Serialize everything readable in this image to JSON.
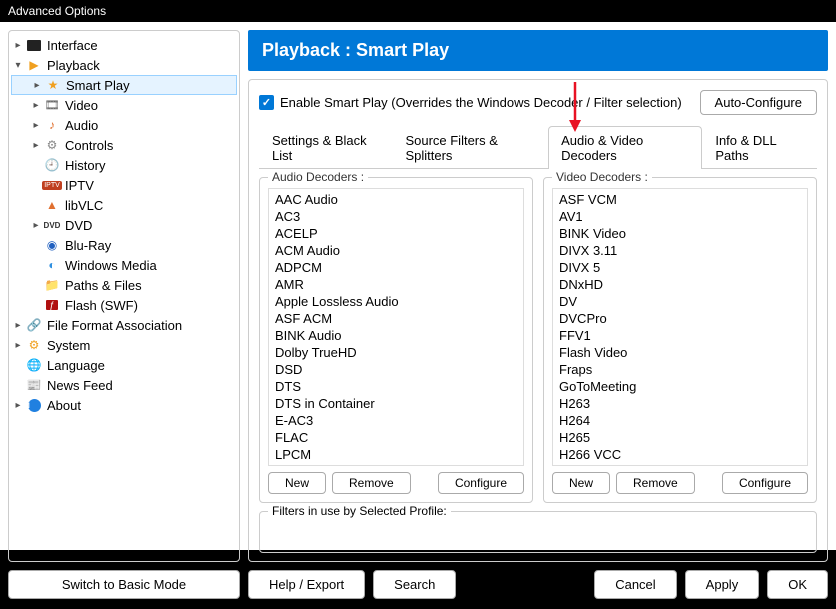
{
  "window_title": "Advanced Options",
  "header": "Playback : Smart Play",
  "enable_label": "Enable Smart Play (Overrides the Windows Decoder / Filter selection)",
  "auto_configure": "Auto-Configure",
  "tabs": {
    "settings": "Settings & Black List",
    "source": "Source Filters & Splitters",
    "decoders": "Audio & Video Decoders",
    "info": "Info & DLL Paths"
  },
  "audio_group": "Audio Decoders :",
  "video_group": "Video Decoders :",
  "audio_decoders": [
    "AAC Audio",
    "AC3",
    "ACELP",
    "ACM Audio",
    "ADPCM",
    "AMR",
    "Apple Lossless Audio",
    "ASF ACM",
    "BINK Audio",
    "Dolby TrueHD",
    "DSD",
    "DTS",
    "DTS in Container",
    "E-AC3",
    "FLAC",
    "LPCM"
  ],
  "video_decoders": [
    "ASF VCM",
    "AV1",
    "BINK Video",
    "DIVX 3.11",
    "DIVX 5",
    "DNxHD",
    "DV",
    "DVCPro",
    "FFV1",
    "Flash Video",
    "Fraps",
    "GoToMeeting",
    "H263",
    "H264",
    "H265",
    "H266 VCC"
  ],
  "btn_new": "New",
  "btn_remove": "Remove",
  "btn_configure": "Configure",
  "filters_label": "Filters in use by Selected Profile:",
  "tree": {
    "interface": "Interface",
    "playback": "Playback",
    "smart_play": "Smart Play",
    "video": "Video",
    "audio": "Audio",
    "controls": "Controls",
    "history": "History",
    "iptv": "IPTV",
    "libvlc": "libVLC",
    "dvd": "DVD",
    "bluray": "Blu-Ray",
    "wm": "Windows Media",
    "paths": "Paths & Files",
    "flash": "Flash (SWF)",
    "ffa": "File Format Association",
    "system": "System",
    "language": "Language",
    "news": "News Feed",
    "about": "About"
  },
  "footer": {
    "basic": "Switch to Basic Mode",
    "help": "Help / Export",
    "search": "Search",
    "cancel": "Cancel",
    "apply": "Apply",
    "ok": "OK"
  }
}
